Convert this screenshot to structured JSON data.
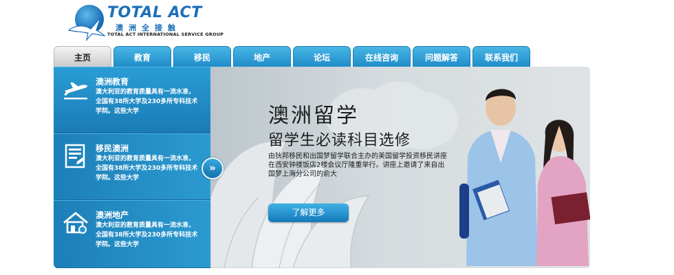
{
  "logo": {
    "title": "TOTAL ACT",
    "chinese": "澳洲全接触",
    "subtitle": "TOTAL ACT INTERNATIONAL SERVICE GROUP",
    "icon": "globe-bird-icon"
  },
  "nav": {
    "tabs": [
      {
        "label": "主页",
        "active": true
      },
      {
        "label": "教育",
        "active": false
      },
      {
        "label": "移民",
        "active": false
      },
      {
        "label": "地产",
        "active": false
      },
      {
        "label": "论坛",
        "active": false
      },
      {
        "label": "在线咨询",
        "active": false
      },
      {
        "label": "问题解答",
        "active": false
      },
      {
        "label": "联系我们",
        "active": false
      }
    ]
  },
  "sidebar": {
    "items": [
      {
        "title": "澳洲教育",
        "desc": "澳大利亚的教育质量具有一流水准，全国有38所大学及230多所专科技术学院。这些大学",
        "icon": "airplane-icon",
        "active": true
      },
      {
        "title": "移民澳洲",
        "desc": "澳大利亚的教育质量具有一流水准，全国有38所大学及230多所专科技术学院。这些大学",
        "icon": "document-icon",
        "active": false
      },
      {
        "title": "澳洲地产",
        "desc": "澳大利亚的教育质量具有一流水准，全国有38所大学及230多所专科技术学院。这些大学",
        "icon": "house-icon",
        "active": false
      }
    ]
  },
  "banner": {
    "arrow": "»",
    "headline": "澳洲留学",
    "subhead": "留学生必读科目选修",
    "body": "由狄邦移民和出国梦留学联合主办的美国留学投资移民讲座在西安钟楼饭店2楼会议厅隆重举行。讲座上邀请了来自出国梦上海分公司的俞大",
    "more_button": "了解更多"
  },
  "colors": {
    "accent": "#1c8ac6",
    "brand": "#1b6fb8",
    "tab_active": "#d8d8d8"
  }
}
